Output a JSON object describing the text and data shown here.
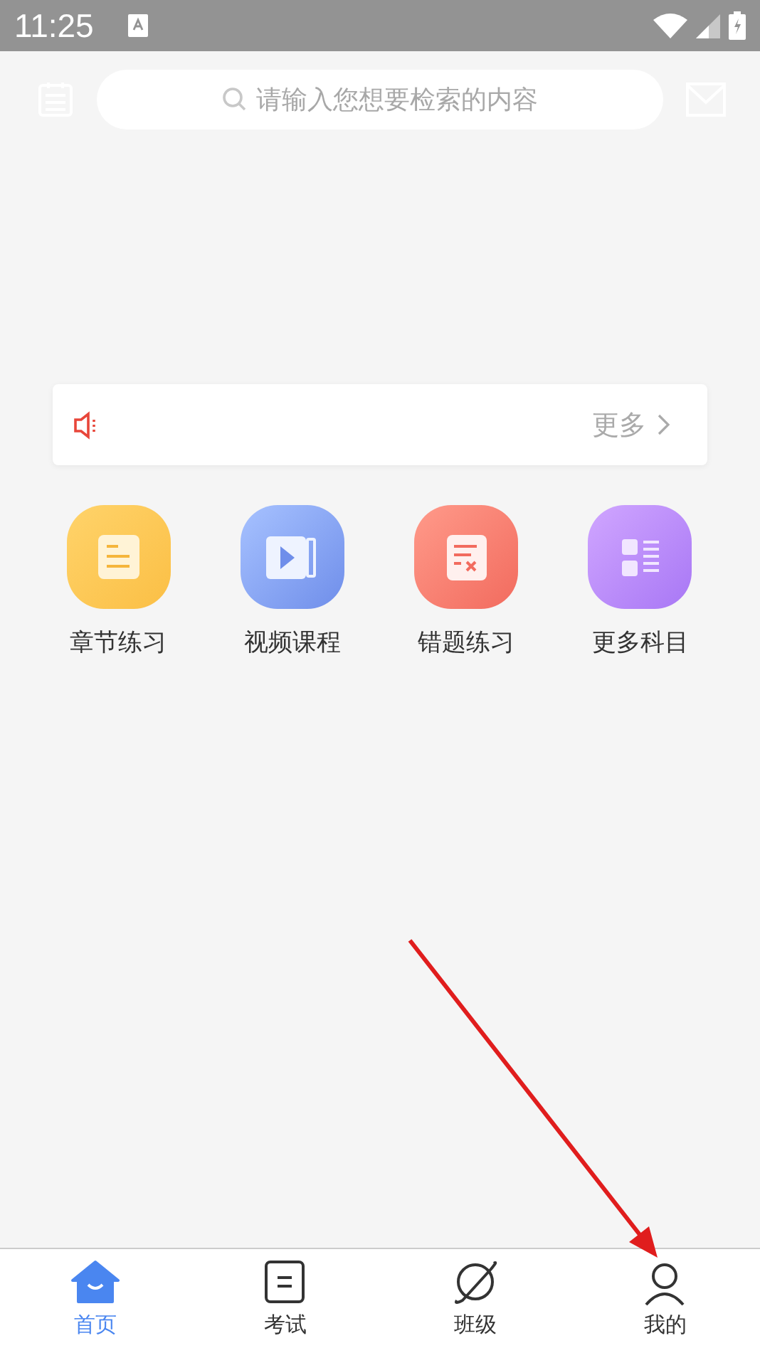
{
  "status_bar": {
    "time": "11:25"
  },
  "search": {
    "placeholder": "请输入您想要检索的内容"
  },
  "notice": {
    "more": "更多"
  },
  "shortcuts": [
    {
      "label": "章节练习",
      "kind": "chapter"
    },
    {
      "label": "视频课程",
      "kind": "video"
    },
    {
      "label": "错题练习",
      "kind": "mistakes"
    },
    {
      "label": "更多科目",
      "kind": "subjects"
    }
  ],
  "tab_bar": [
    {
      "label": "首页",
      "kind": "home",
      "selected": true
    },
    {
      "label": "考试",
      "kind": "exam",
      "selected": false
    },
    {
      "label": "班级",
      "kind": "class",
      "selected": false
    },
    {
      "label": "我的",
      "kind": "profile",
      "selected": false
    }
  ]
}
